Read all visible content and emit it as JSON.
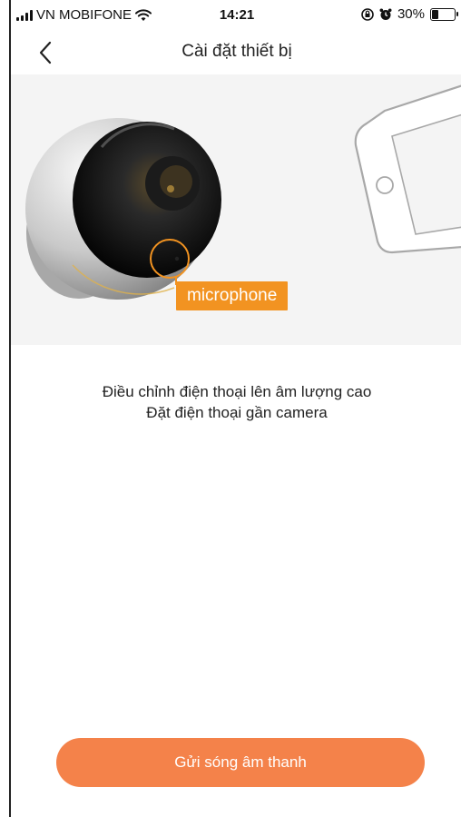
{
  "status_bar": {
    "carrier": "VN MOBIFONE",
    "time": "14:21",
    "battery": "30%",
    "battery_level": 0.3,
    "icons": [
      "signal-icon",
      "wifi-icon",
      "orientation-lock-icon",
      "alarm-icon",
      "battery-icon"
    ]
  },
  "nav": {
    "title": "Cài đặt thiết bị",
    "back_icon": "chevron-left-icon"
  },
  "hero": {
    "label": "microphone",
    "accent": "#f29321",
    "wave_colors": [
      "#f29321",
      "#e8458b"
    ]
  },
  "instructions": {
    "line1": "Điều chỉnh điện thoại lên âm lượng cao",
    "line2": "Đặt điện thoại gần camera"
  },
  "action": {
    "send_label": "Gửi sóng âm thanh",
    "color": "#f4824a"
  }
}
